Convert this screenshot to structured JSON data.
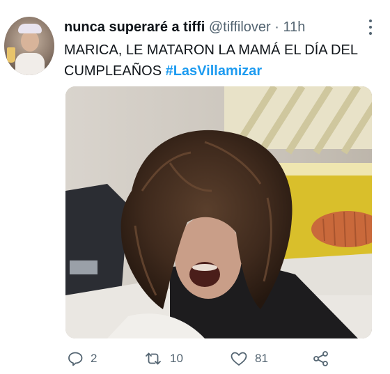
{
  "tweet": {
    "author": {
      "name": "nunca superaré a tiffi",
      "handle": "@tiffilover",
      "separator": "·",
      "time": "11h"
    },
    "text": "MARICA, LE MATARON LA MAMÁ EL DÍA DEL CUMPLEAÑOS ",
    "hashtag": "#LasVillamizar",
    "actions": {
      "replies": "2",
      "retweets": "10",
      "likes": "81"
    }
  },
  "icons": [
    "more-options-icon",
    "reply-icon",
    "retweet-icon",
    "like-icon",
    "share-icon"
  ],
  "colors": {
    "hashtag": "#1d9bf0",
    "secondary_text": "#536471",
    "primary_text": "#0f1419"
  }
}
